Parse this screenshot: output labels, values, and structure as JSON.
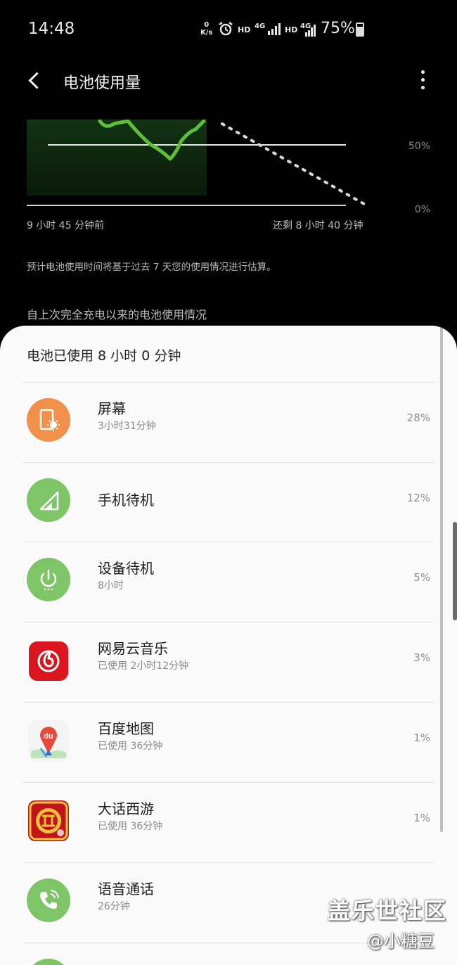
{
  "status_bar": {
    "time": "14:48",
    "net_speed": "0\nK/s",
    "hd1": "HD",
    "net1": "4G",
    "hd2": "HD",
    "net2": "4G",
    "battery_percent": "75%"
  },
  "app_bar": {
    "title": "电池使用量"
  },
  "chart": {
    "ticks": [
      "50%",
      "0%"
    ],
    "left_label": "9 小时 45 分钟前",
    "right_label": "还剩 8 小时 40 分钟",
    "colors": {
      "usage_line": "#5fbf3a",
      "prediction": "#d9d9d9"
    }
  },
  "note": "预计电池使用时间将基于过去 7 天您的使用情况进行估算。",
  "section_header": "自上次完全充电以来的电池使用情况",
  "sheet": {
    "title": "电池已使用 8 小时 0 分钟",
    "items": [
      {
        "name": "屏幕",
        "sub": "3小时31分钟",
        "pct": "28%",
        "icon": "screen-brightness-icon",
        "color": "#f0904a"
      },
      {
        "name": "手机待机",
        "sub": "",
        "pct": "12%",
        "icon": "signal-icon",
        "color": "#7dc567"
      },
      {
        "name": "设备待机",
        "sub": "8小时",
        "pct": "5%",
        "icon": "power-icon",
        "color": "#7dc567"
      },
      {
        "name": "网易云音乐",
        "sub": "已使用 2小时12分钟",
        "pct": "3%",
        "icon": "netease-music-icon",
        "color": "#d9161d"
      },
      {
        "name": "百度地图",
        "sub": "已使用 36分钟",
        "pct": "1%",
        "icon": "baidu-map-icon",
        "color": "#e84a3a"
      },
      {
        "name": "大话西游",
        "sub": "已使用 36分钟",
        "pct": "1%",
        "icon": "game-icon",
        "color": "#c0141a"
      },
      {
        "name": "语音通话",
        "sub": "26分钟",
        "pct": "",
        "icon": "phone-icon",
        "color": "#7dc567"
      }
    ]
  },
  "watermark": {
    "line1": "盖乐世社区",
    "line2": "@小糖豆"
  }
}
